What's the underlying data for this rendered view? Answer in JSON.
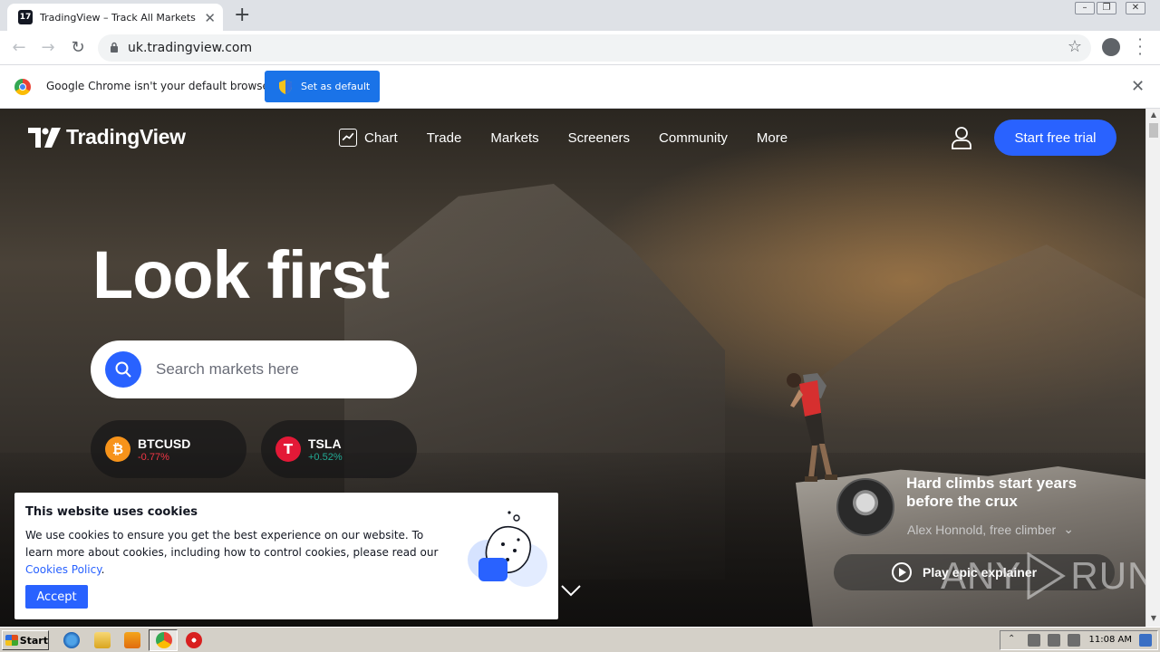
{
  "browser": {
    "tab_title": "TradingView – Track All Markets",
    "tab_favicon_text": "17",
    "url": "uk.tradingview.com",
    "infobar_message": "Google Chrome isn't your default browser",
    "infobar_button": "Set as default"
  },
  "site": {
    "logo_text": "TradingView",
    "nav": [
      "Chart",
      "Trade",
      "Markets",
      "Screeners",
      "Community",
      "More"
    ],
    "cta": "Start free trial",
    "hero_title": "Look first",
    "search_placeholder": "Search markets here",
    "tickers": [
      {
        "symbol": "BTCUSD",
        "change": "-0.77%",
        "icon": "bitcoin-icon",
        "icon_glyph": "₿",
        "color": "#f7931a",
        "change_color": "#f23645"
      },
      {
        "symbol": "TSLA",
        "change": "+0.52%",
        "icon": "tesla-icon",
        "icon_glyph": "T",
        "color": "#e31937",
        "change_color": "#22ab94"
      }
    ],
    "quote": {
      "text": "Hard climbs start years before the crux",
      "author": "Alex Honnold, free climber",
      "play_label": "Play epic explainer"
    },
    "accent_color": "#2962ff"
  },
  "cookie": {
    "title": "This website uses cookies",
    "body": "We use cookies to ensure you get the best experience on our website. To learn more about cookies, including how to control cookies, please read our ",
    "link": "Cookies Policy",
    "body_end": ".",
    "accept": "Accept"
  },
  "watermark": {
    "left": "ANY",
    "right": "RUN"
  },
  "taskbar": {
    "start": "Start",
    "clock": "11:08 AM"
  }
}
